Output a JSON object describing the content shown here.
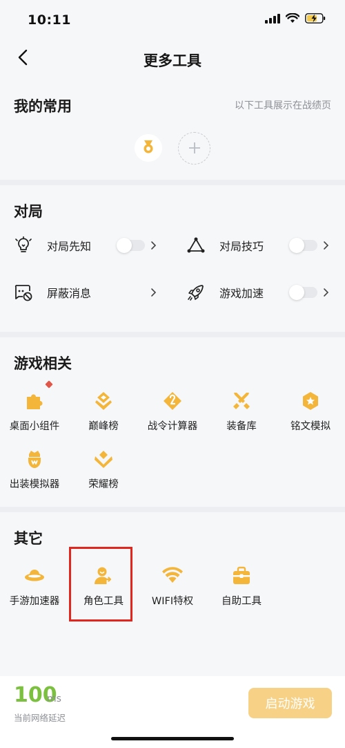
{
  "status": {
    "time": "10:11"
  },
  "nav": {
    "title": "更多工具"
  },
  "favorites": {
    "title": "我的常用",
    "note": "以下工具展示在战绩页"
  },
  "match": {
    "title": "对局",
    "items": [
      {
        "label": "对局先知",
        "icon": "lightbulb-icon",
        "toggle": true
      },
      {
        "label": "对局技巧",
        "icon": "triangle-nodes-icon",
        "toggle": true
      },
      {
        "label": "屏蔽消息",
        "icon": "message-block-icon",
        "toggle": false
      },
      {
        "label": "游戏加速",
        "icon": "rocket-icon",
        "toggle": true
      }
    ]
  },
  "game": {
    "title": "游戏相关",
    "items": [
      {
        "label": "桌面小组件",
        "icon": "puzzle-icon"
      },
      {
        "label": "巅峰榜",
        "icon": "peak-rank-icon"
      },
      {
        "label": "战令计算器",
        "icon": "battle-pass-icon"
      },
      {
        "label": "装备库",
        "icon": "swords-icon"
      },
      {
        "label": "铭文模拟",
        "icon": "inscription-icon"
      },
      {
        "label": "出装模拟器",
        "icon": "equipment-sim-icon"
      },
      {
        "label": "荣耀榜",
        "icon": "glory-rank-icon"
      }
    ]
  },
  "other": {
    "title": "其它",
    "items": [
      {
        "label": "手游加速器",
        "icon": "ufo-icon"
      },
      {
        "label": "角色工具",
        "icon": "role-tool-icon"
      },
      {
        "label": "WIFI特权",
        "icon": "wifi-icon"
      },
      {
        "label": "自助工具",
        "icon": "toolbox-icon"
      }
    ]
  },
  "bottom": {
    "latency_value": "100",
    "latency_unit": "ms",
    "latency_label": "当前网络延迟",
    "start_label": "启动游戏"
  },
  "colors": {
    "accent_gold": "#f3b53a",
    "latency_green": "#7cc040",
    "button_disabled": "#f6d186",
    "highlight_red": "#e2261d"
  }
}
